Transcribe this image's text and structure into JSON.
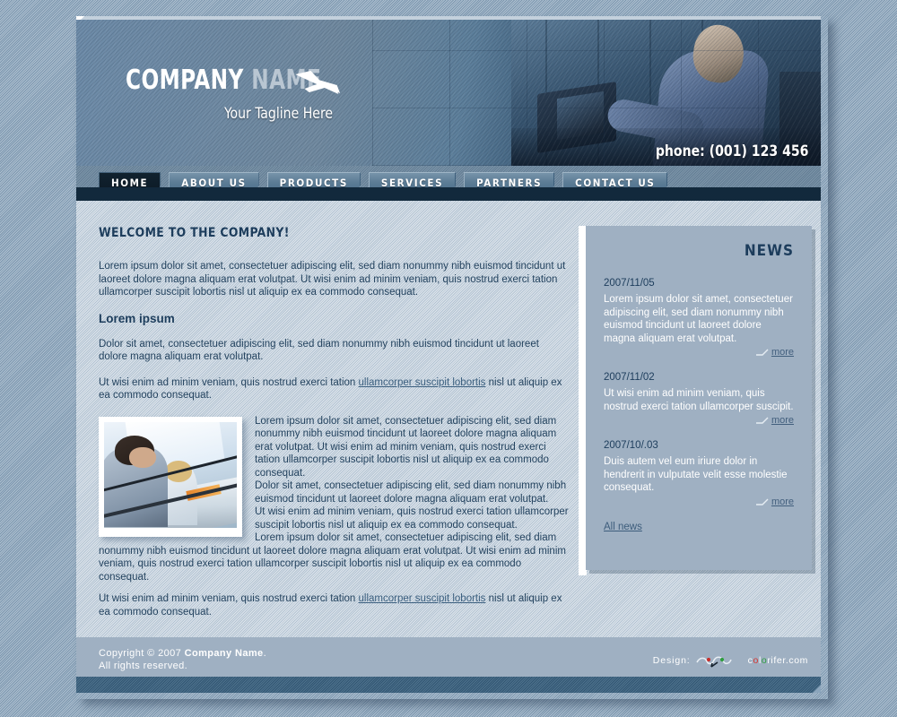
{
  "header": {
    "logo_primary": "COMPANY",
    "logo_secondary": "NAME",
    "tagline": "Your Tagline Here",
    "phone": "phone: (001) 123 456",
    "plane_icon": "airplane-icon",
    "photo_alt": "businessman-working-on-laptop"
  },
  "nav": {
    "items": [
      {
        "label": "HOME",
        "active": true
      },
      {
        "label": "ABOUT US",
        "active": false
      },
      {
        "label": "PRODUCTS",
        "active": false
      },
      {
        "label": "SERVICES",
        "active": false
      },
      {
        "label": "PARTNERS",
        "active": false
      },
      {
        "label": "CONTACT US",
        "active": false
      }
    ]
  },
  "main": {
    "welcome_heading": "WELCOME TO THE COMPANY!",
    "intro_paragraph": "Lorem ipsum dolor sit amet, consectetuer adipiscing elit, sed diam nonummy nibh euismod tincidunt ut laoreet dolore magna aliquam erat volutpat. Ut wisi enim ad minim veniam, quis nostrud exerci tation ullamcorper suscipit lobortis nisl ut aliquip ex ea commodo consequat.",
    "section_heading": "Lorem ipsum",
    "section_paragraph_1": "Dolor sit amet, consectetuer adipiscing elit, sed diam nonummy nibh euismod tincidunt ut laoreet dolore magna aliquam erat volutpat.",
    "section_paragraph_2_pre": "Ut wisi enim ad minim veniam, quis nostrud exerci tation ",
    "section_paragraph_2_link": "ullamcorper suscipit lobortis",
    "section_paragraph_2_post": " nisl ut aliquip ex ea commodo consequat.",
    "photo_alt": "two-colleagues-at-office-desk",
    "float_paragraph_1": "Lorem ipsum dolor sit amet, consectetuer adipiscing elit, sed diam nonummy nibh euismod tincidunt ut laoreet dolore magna aliquam erat volutpat. Ut wisi enim ad minim veniam, quis nostrud exerci tation ullamcorper suscipit lobortis nisl ut aliquip ex ea commodo consequat.",
    "float_paragraph_2": "Dolor sit amet, consectetuer adipiscing elit, sed diam nonummy nibh euismod tincidunt ut laoreet dolore magna aliquam erat volutpat.",
    "float_paragraph_3": "Ut wisi enim ad minim veniam, quis nostrud exerci tation ullamcorper suscipit lobortis nisl ut aliquip ex ea commodo consequat.",
    "float_paragraph_4": "Lorem ipsum dolor sit amet, consectetuer adipiscing elit, sed diam nonummy nibh euismod tincidunt ut laoreet dolore magna aliquam erat volutpat. Ut wisi enim ad minim veniam, quis nostrud exerci tation ullamcorper suscipit lobortis nisl ut aliquip ex ea commodo consequat.",
    "tail_paragraph_pre": "Ut wisi enim ad minim veniam, quis nostrud exerci tation ",
    "tail_paragraph_link": "ullamcorper suscipit lobortis",
    "tail_paragraph_post": " nisl ut aliquip ex ea commodo consequat."
  },
  "news": {
    "title": "NEWS",
    "more_label": "more",
    "all_news_label": "All news",
    "items": [
      {
        "date": "2007/11/05",
        "text": "Lorem ipsum dolor sit amet, consectetuer adipiscing elit, sed diam nonummy nibh euismod tincidunt ut laoreet dolore magna aliquam erat volutpat."
      },
      {
        "date": "2007/11/02",
        "text": "Ut wisi enim ad minim veniam, quis nostrud exerci tation ullamcorper suscipit."
      },
      {
        "date": "2007/10/.03",
        "text": "Duis autem vel eum iriure dolor in hendrerit in vulputate velit esse molestie consequat."
      }
    ]
  },
  "footer": {
    "copyright_pre": "Copyright © 2007 ",
    "copyright_company": "Company Name",
    "copyright_post": ".",
    "rights": "All rights reserved.",
    "design_label": "Design:",
    "design_domain_prefix": "c",
    "design_domain_c1": "o",
    "design_domain_mid": "l",
    "design_domain_c2": "o",
    "design_domain_suffix": "rifer.com"
  },
  "colors": {
    "page_background": "#8ba5bc",
    "content_background": "#c3d0dc",
    "panel_background": "#9fb0c2",
    "accent_dark": "#1d3d5c",
    "nav_dark": "#12293c",
    "link": "#3a5e7e"
  }
}
